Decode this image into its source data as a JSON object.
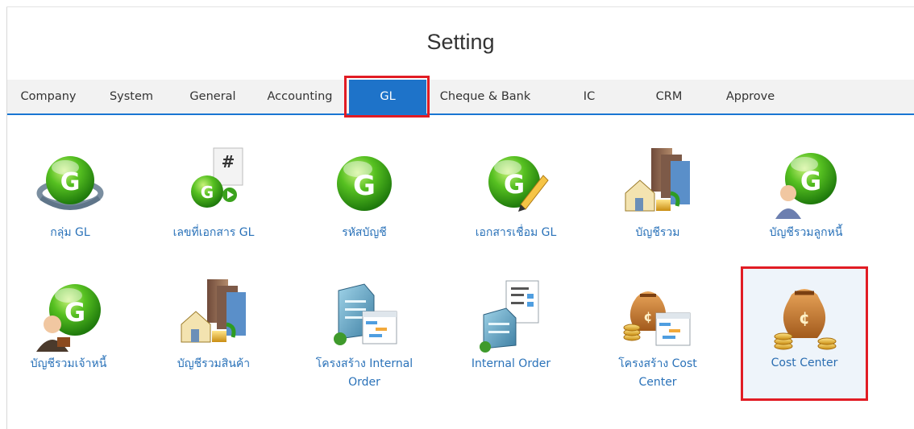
{
  "page_title": "Setting",
  "tabs": [
    {
      "label": "Company"
    },
    {
      "label": "System"
    },
    {
      "label": "General"
    },
    {
      "label": "Accounting"
    },
    {
      "label": "GL",
      "active": true
    },
    {
      "label": "Cheque & Bank"
    },
    {
      "label": "IC"
    },
    {
      "label": "CRM"
    },
    {
      "label": "Approve"
    }
  ],
  "row1": [
    {
      "label": "กลุ่ม GL",
      "icon": "gl-group-icon"
    },
    {
      "label": "เลขที่เอกสาร GL",
      "icon": "gl-document-number-icon"
    },
    {
      "label": "รหัสบัญชี",
      "icon": "gl-account-code-icon"
    },
    {
      "label": "เอกสารเชื่อม GL",
      "icon": "gl-link-document-icon"
    },
    {
      "label": "บัญชีรวม",
      "icon": "summary-account-icon"
    },
    {
      "label": "บัญชีรวมลูกหนี้",
      "icon": "debtor-summary-account-icon"
    }
  ],
  "row2": [
    {
      "label": "บัญชีรวมเจ้าหนี้",
      "icon": "creditor-summary-account-icon"
    },
    {
      "label": "บัญชีรวมสินค้า",
      "icon": "inventory-summary-account-icon"
    },
    {
      "label_line1": "โครงสร้าง Internal",
      "label_line2": "Order",
      "icon": "internal-order-structure-icon"
    },
    {
      "label": "Internal Order",
      "icon": "internal-order-icon"
    },
    {
      "label_line1": "โครงสร้าง Cost",
      "label_line2": "Center",
      "icon": "cost-center-structure-icon"
    },
    {
      "label": "Cost Center",
      "icon": "cost-center-icon",
      "selected": true
    }
  ],
  "colors": {
    "accent": "#1e73c9",
    "highlight": "#e11c24",
    "link": "#2a72b9",
    "gl_green": "#3fae1f"
  }
}
